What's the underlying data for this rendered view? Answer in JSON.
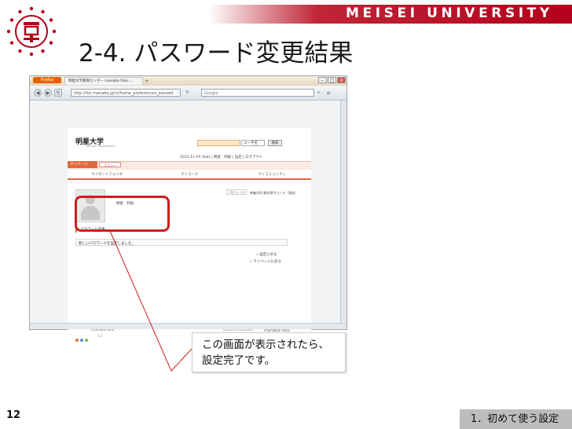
{
  "header": {
    "university_name": "MEISEI UNIVERSITY",
    "slide_title": "2-4. パスワード変更結果"
  },
  "browser": {
    "firefox_button": "Firefox",
    "tab_title": "明星大学教育センター manaba folio -...",
    "new_tab": "+",
    "window_controls": [
      "−",
      "□",
      "×"
    ],
    "url": "http://loc.manaba.jp/ct/home_preferences_passwd",
    "search_placeholder": "Google"
  },
  "site": {
    "logo_text": "明星大学",
    "logo_sub": "MEISEI UNIVERSITY",
    "user_select": "ユーザ名",
    "search_button": "検索",
    "status_line": "2011-11-19 (Sat) | 明星　利助 | 設定 | ログアウト",
    "tab_mypage": "マイページ",
    "tab_menu": "メニュー",
    "submenu": [
      "マイポートフォリオ",
      "マイコース",
      "マイコミュニティ"
    ],
    "user_name": "明星　利助",
    "profile_button": "プロフィール",
    "affiliation": "教養学科 教科専門コース（更級）",
    "section_title": "パスワード変更",
    "message": "新しいパスワードを設定しました。",
    "link_settings": "» 設定に戻る",
    "link_mypage": "» マイページに戻る",
    "footer_brand": "manaba folio",
    "footer_version": "1.2",
    "footer_powered": "Powered by manaba folio ©2008 ASAHI Net,Inc.",
    "footer_logo": "manaba folio"
  },
  "callout_text": "この画面が表示されたら、設定完了です。",
  "footer": {
    "page_number": "12",
    "section": "1．初めて使う設定"
  },
  "colors": {
    "brand_red": "#b3001b",
    "callout_red": "#cc1f1f",
    "site_orange": "#e06a3f"
  }
}
